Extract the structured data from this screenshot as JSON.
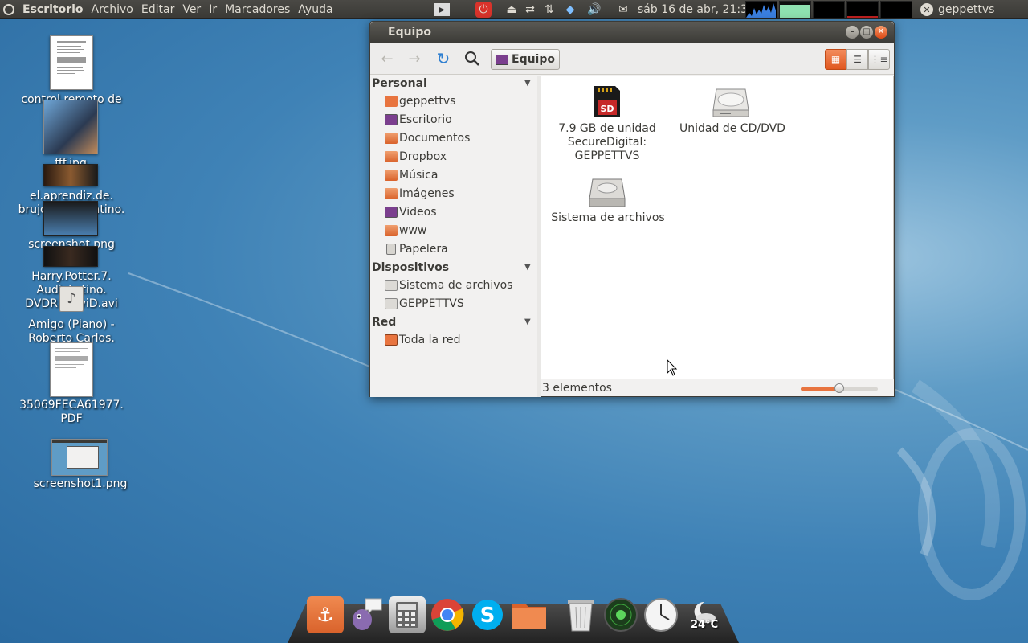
{
  "top_panel": {
    "menus": [
      "Escritorio",
      "Archivo",
      "Editar",
      "Ver",
      "Ir",
      "Marcadores",
      "Ayuda"
    ],
    "clock": "sáb 16 de abr, 21:31",
    "user": "geppettvs"
  },
  "desktop": {
    "icons": [
      {
        "label": "control remoto de"
      },
      {
        "label": "fff.jpg"
      },
      {
        "label": "el.aprendiz.de.\nbrujo.dvdrip.latino.\navi"
      },
      {
        "label": "screenshot.png"
      },
      {
        "label": "Harry.Potter.7.\nAudioLatino.\nDVDRip.XviD.avi"
      },
      {
        "label": "Amigo (Piano) -\nRoberto Carlos."
      },
      {
        "label": "35069FECA61977.\nPDF"
      },
      {
        "label": "screenshot1.png"
      }
    ]
  },
  "window": {
    "title": "Equipo",
    "path_button": "Equipo",
    "sidebar": {
      "personal_header": "Personal",
      "personal_items": [
        "geppettvs",
        "Escritorio",
        "Documentos",
        "Dropbox",
        "Música",
        "Imágenes",
        "Videos",
        "www",
        "Papelera"
      ],
      "devices_header": "Dispositivos",
      "device_items": [
        "Sistema de archivos",
        "GEPPETTVS"
      ],
      "network_header": "Red",
      "network_items": [
        "Toda la red"
      ]
    },
    "content_items": [
      {
        "label": "7.9 GB de unidad\nSecureDigital:\nGEPPETTVS",
        "icon": "sd-card-icon"
      },
      {
        "label": "Unidad de CD/DVD",
        "icon": "optical-drive-icon"
      },
      {
        "label": "Sistema de archivos",
        "icon": "hard-drive-icon"
      }
    ],
    "status": "3 elementos",
    "zoom_level": 0.5
  },
  "dock": {
    "weather_temp": "24°C"
  },
  "colors": {
    "accent": "#e8743f",
    "panel": "#3c3b37",
    "wallpaper": "#3f82b6"
  }
}
